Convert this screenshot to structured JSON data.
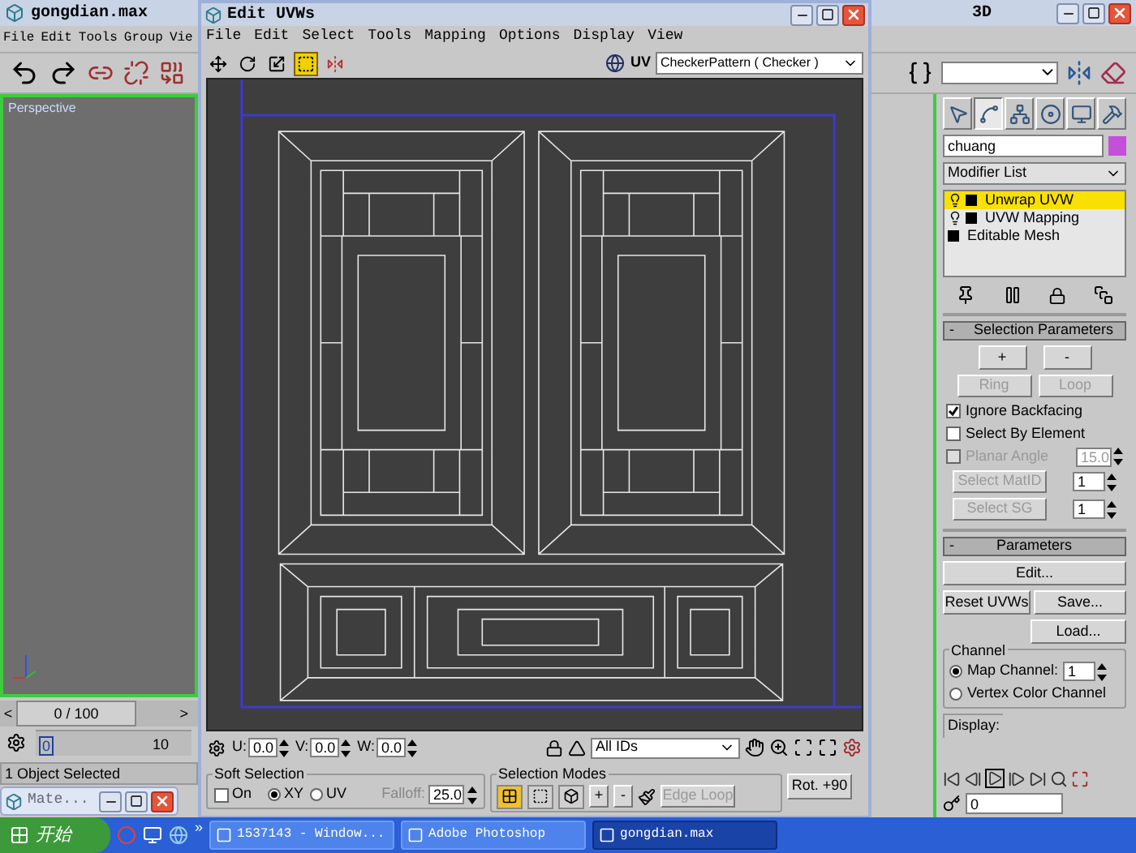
{
  "main_window": {
    "title": "gongdian.max",
    "title_tail": "3D",
    "menu": [
      "File",
      "Edit",
      "Tools",
      "Group",
      "Vie"
    ],
    "viewport": {
      "label": "Perspective"
    },
    "time_slider": {
      "prev": "<",
      "label": "0 / 100",
      "next": ">"
    },
    "track_ticks": [
      "0",
      "10"
    ],
    "status": "1 Object Selected",
    "frame_field": "0",
    "command_panel": {
      "panel_tabs": [
        {
          "kind": "create",
          "selected": false
        },
        {
          "kind": "modify",
          "selected": true
        },
        {
          "kind": "hierarchy",
          "selected": false
        },
        {
          "kind": "motion",
          "selected": false
        },
        {
          "kind": "display",
          "selected": false
        },
        {
          "kind": "utilities",
          "selected": false
        }
      ],
      "object_name": "chuang",
      "modifier_list": "Modifier List",
      "stack": [
        {
          "label": "Unwrap UVW",
          "selected": true,
          "bulb": true
        },
        {
          "label": "UVW Mapping",
          "selected": false,
          "bulb": true
        },
        {
          "label": "Editable Mesh",
          "selected": false,
          "bulb": false
        }
      ],
      "rollouts": [
        {
          "sign": "-",
          "title": "Selection Parameters"
        },
        {
          "sign": "-",
          "title": "Parameters"
        }
      ],
      "grow_buttons": [
        "+",
        "-"
      ],
      "ring_loop": [
        {
          "label": "Ring",
          "disabled": true
        },
        {
          "label": "Loop",
          "disabled": true
        }
      ],
      "checkboxes": [
        {
          "label": "Ignore Backfacing",
          "checked": true,
          "disabled": false
        },
        {
          "label": "Select By Element",
          "checked": false,
          "disabled": false
        },
        {
          "label": "Planar Angle",
          "checked": false,
          "disabled": true,
          "value": "15.0"
        }
      ],
      "select_rows": [
        {
          "label": "Select MatID",
          "disabled": true,
          "value": "1"
        },
        {
          "label": "Select SG",
          "disabled": true,
          "value": "1"
        }
      ],
      "edit": "Edit...",
      "reset": "Reset UVWs",
      "save": "Save...",
      "load": "Load...",
      "channel": {
        "title": "Channel",
        "options": [
          {
            "label": "Map Channel:",
            "selected": true,
            "value": "1"
          },
          {
            "label": "Vertex Color Channel",
            "selected": false
          }
        ]
      },
      "display_label": "Display:"
    }
  },
  "uv_editor": {
    "title": "Edit UVWs",
    "menu": [
      "File",
      "Edit",
      "Select",
      "Tools",
      "Mapping",
      "Options",
      "Display",
      "View"
    ],
    "tools": [
      {
        "kind": "move",
        "selected": false
      },
      {
        "kind": "rotate",
        "selected": false
      },
      {
        "kind": "scale",
        "selected": false
      },
      {
        "kind": "freeform",
        "selected": true
      },
      {
        "kind": "mirror",
        "selected": false
      }
    ],
    "uv_label": "UV",
    "texture": "CheckerPattern ( Checker )",
    "coords": [
      {
        "label": "U:",
        "value": "0.0"
      },
      {
        "label": "V:",
        "value": "0.0"
      },
      {
        "label": "W:",
        "value": "0.0"
      }
    ],
    "id_filter": "All IDs",
    "soft_selection": {
      "title": "Soft Selection",
      "on": {
        "label": "On",
        "checked": false
      },
      "axes": [
        {
          "label": "XY",
          "selected": true
        },
        {
          "label": "UV",
          "selected": false
        }
      ],
      "falloff_label": "Falloff:",
      "falloff": "25.0"
    },
    "selection_modes": {
      "title": "Selection Modes",
      "modes": [
        {
          "kind": "vertex",
          "selected": true
        },
        {
          "kind": "edge",
          "selected": false
        },
        {
          "kind": "face",
          "selected": false
        }
      ],
      "buttons": [
        "+",
        "-"
      ],
      "edge_loop": "Edge Loop"
    },
    "rotate": "Rot. +90"
  },
  "minimized_window": {
    "title": "Mate..."
  },
  "taskbar": {
    "start": "开始",
    "overflow": "»",
    "tasks": [
      {
        "label": "1537143 - Window...",
        "selected": false
      },
      {
        "label": "Adobe Photoshop",
        "selected": false
      },
      {
        "label": "gongdian.max",
        "selected": true
      }
    ]
  }
}
